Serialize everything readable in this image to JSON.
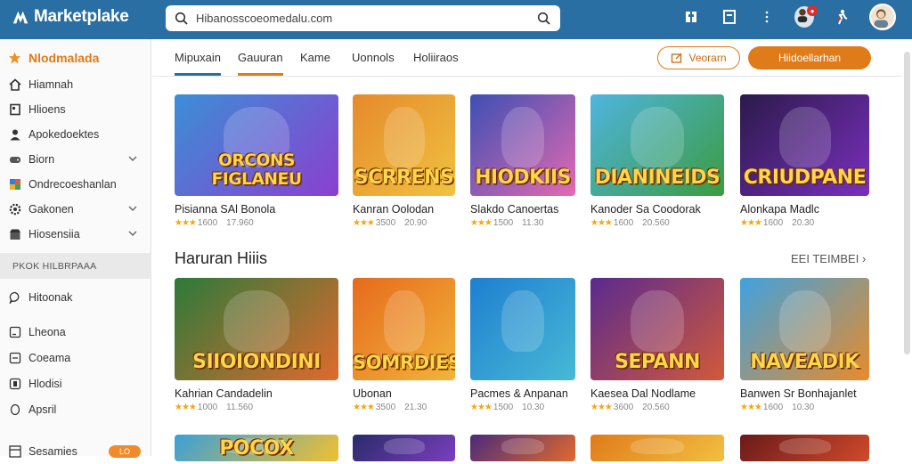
{
  "app": {
    "logo_text": "Marketplake"
  },
  "search": {
    "value": "Hibanosscoeomedalu.com"
  },
  "colors": {
    "topbar": "#2a6fa3",
    "accent_orange": "#e07b1a",
    "notification_badge": "#d9302c"
  },
  "topbar_icons": [
    "grid-icon",
    "library-icon",
    "more-icon",
    "notification-avatar-icon",
    "user-run-icon",
    "profile-avatar"
  ],
  "sidebar": {
    "featured": "Nlodmalada",
    "items": [
      {
        "label": "Hiamnah",
        "icon": "home-icon",
        "has_chevron": false
      },
      {
        "label": "Hlioens",
        "icon": "book-icon",
        "has_chevron": false
      },
      {
        "label": "Apokedoektes",
        "icon": "person-icon",
        "has_chevron": false
      },
      {
        "label": "Biorn",
        "icon": "gamepad-icon",
        "has_chevron": true
      },
      {
        "label": "Ondrecoeshanlan",
        "icon": "palette-icon",
        "has_chevron": false
      },
      {
        "label": "Gakonen",
        "icon": "gear-icon",
        "has_chevron": true
      },
      {
        "label": "Hiosensiia",
        "icon": "store-icon",
        "has_chevron": true
      }
    ],
    "section_header": "PKOK HILBRPAAA",
    "section_items": [
      {
        "label": "Hitoonak",
        "icon": "chat-icon"
      },
      {
        "label": "Lheona",
        "icon": "window-icon"
      },
      {
        "label": "Coeama",
        "icon": "window-icon"
      },
      {
        "label": "Hlodisi",
        "icon": "bookmark-icon"
      },
      {
        "label": "Apsril",
        "icon": "circle-icon"
      }
    ],
    "bottom_item": {
      "label": "Sesamies",
      "pill": "LO"
    }
  },
  "tabs": [
    {
      "label": "Mipuxain",
      "state": "active-blue"
    },
    {
      "label": "Gauuran",
      "state": "active-orange"
    },
    {
      "label": "Kame",
      "state": "normal"
    },
    {
      "label": "Uonnols",
      "state": "normal"
    },
    {
      "label": "Holiiraos",
      "state": "normal"
    }
  ],
  "actions": {
    "outline_button": "Veorarn",
    "solid_button": "Hiidoellarhan"
  },
  "row1": [
    {
      "name": "Pisianna SAl Bonola",
      "rating": "1600",
      "price": "17.960",
      "art": "ORCONS FIGLANEU",
      "bg": [
        "#3b8fd6",
        "#8b3fcf"
      ]
    },
    {
      "name": "Kanran Oolodan",
      "rating": "3500",
      "price": "20.90",
      "art": "SCRRENS",
      "bg": [
        "#e58a2c",
        "#f1c240"
      ]
    },
    {
      "name": "Slakdo Canoertas",
      "rating": "1500",
      "price": "11.30",
      "art": "HIODKIIS",
      "bg": [
        "#3c4fb3",
        "#e46ab2"
      ]
    },
    {
      "name": "Kanoder Sa Coodorak",
      "rating": "1600",
      "price": "20.560",
      "art": "DIANINEIDS",
      "bg": [
        "#4fb4e0",
        "#3b9c3f"
      ]
    },
    {
      "name": "Alonkapa Madlc",
      "rating": "1600",
      "price": "20.30",
      "art": "CRIUDPANE",
      "bg": [
        "#2b1a4a",
        "#7a2fbf"
      ]
    }
  ],
  "section": {
    "title": "Haruran Hiiis",
    "see_all": "EEI TEIMBEI"
  },
  "row2": [
    {
      "name": "Kahrian Candadelin",
      "rating": "1000",
      "price": "11.560",
      "art": "SIIOIONDINI",
      "bg": [
        "#2c7a3a",
        "#e06a2d"
      ]
    },
    {
      "name": "Ubonan",
      "rating": "3500",
      "price": "21.30",
      "art": "SOMRDIES",
      "bg": [
        "#e66a1d",
        "#f2b43a"
      ]
    },
    {
      "name": "Pacmes & Anpanan",
      "rating": "1500",
      "price": "10.30",
      "art": "",
      "bg": [
        "#1f7fd0",
        "#47b9d6"
      ]
    },
    {
      "name": "Kaesea Dal Nodlame",
      "rating": "3600",
      "price": "20.560",
      "art": "SEPANN",
      "bg": [
        "#5a2a8f",
        "#d1593b"
      ]
    },
    {
      "name": "Banwen Sr Bonhajanlet",
      "rating": "1600",
      "price": "10.30",
      "art": "NAVEADIK",
      "bg": [
        "#3fa2e0",
        "#e88b2a"
      ]
    }
  ],
  "row3": [
    {
      "art": "POCOX",
      "bg": [
        "#3aa0d8",
        "#f0c030"
      ]
    },
    {
      "art": "",
      "bg": [
        "#2a2a6a",
        "#7a3fbf"
      ]
    },
    {
      "art": "",
      "bg": [
        "#4a2a7a",
        "#e06a2d"
      ]
    },
    {
      "art": "",
      "bg": [
        "#e07b1a",
        "#f2c040"
      ]
    },
    {
      "art": "",
      "bg": [
        "#6a1a1a",
        "#d04a2a"
      ]
    }
  ]
}
